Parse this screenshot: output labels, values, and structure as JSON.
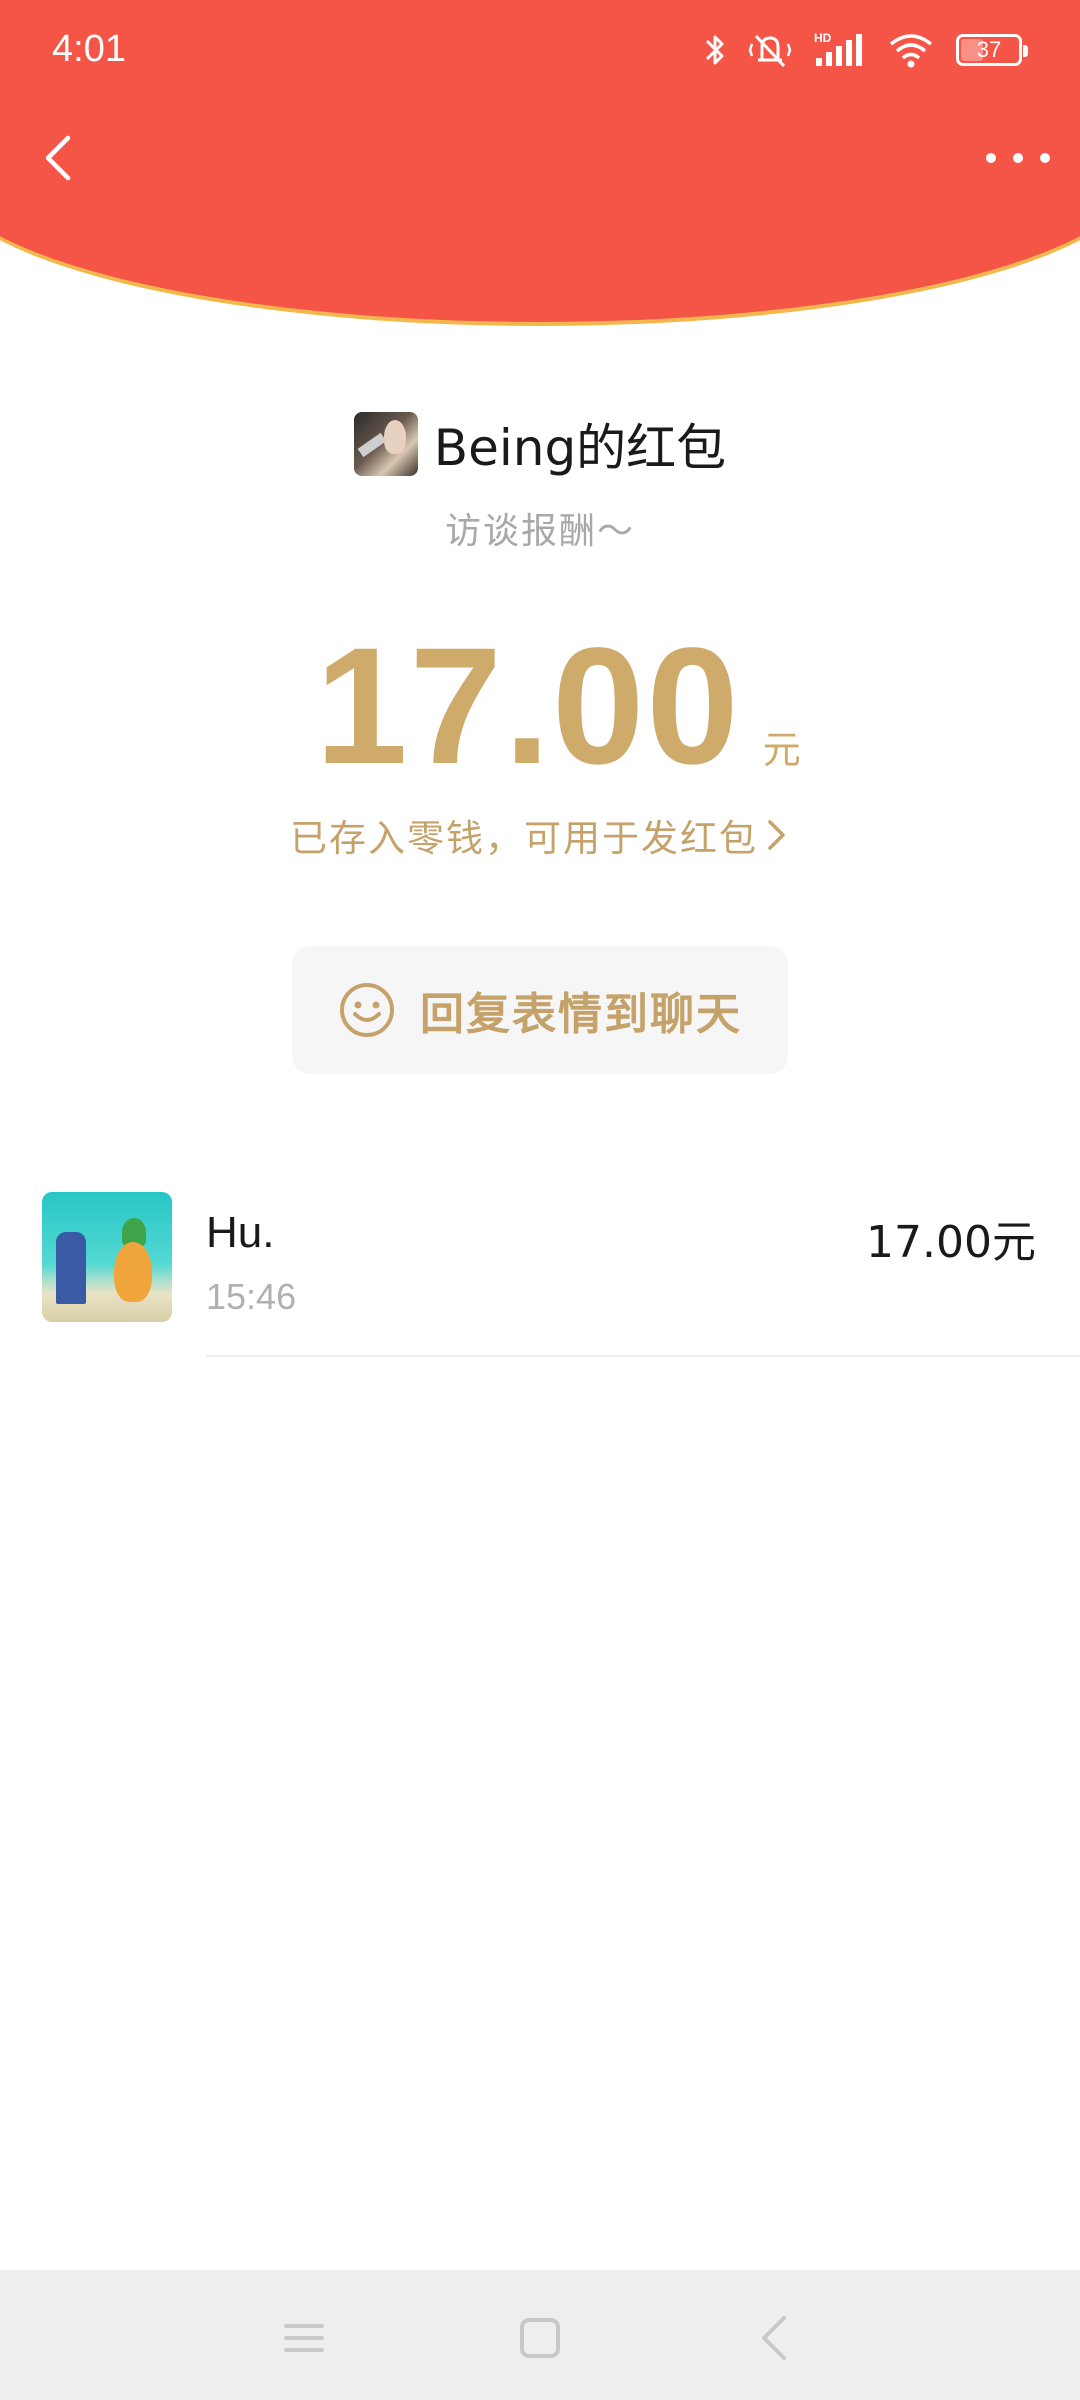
{
  "status_bar": {
    "time": "4:01",
    "battery": "37",
    "hd_label": "HD"
  },
  "colors": {
    "header_red": "#f55546",
    "gold_text": "#cfab6b",
    "header_border": "#f3b84d"
  },
  "nav": {
    "back_icon": "chevron-left-icon",
    "more_icon": "more-horizontal-icon"
  },
  "envelope": {
    "sender_name": "Being的红包",
    "note": "访谈报酬～",
    "amount": "17.00",
    "unit": "元",
    "saved_text": "已存入零钱，可用于发红包",
    "reply_button": "回复表情到聊天"
  },
  "receivers": [
    {
      "name": "Hu.",
      "time": "15:46",
      "amount": "17.00元"
    }
  ]
}
